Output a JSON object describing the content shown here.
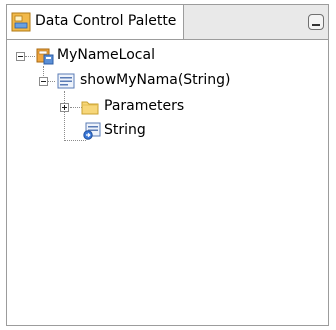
{
  "panel": {
    "tab_title": "Data Control Palette",
    "tab_icon": "data-control-palette-icon",
    "minimize_icon": "minimize-icon"
  },
  "tree": {
    "root": {
      "label": "MyNameLocal",
      "icon": "data-control-icon",
      "expanded": true
    },
    "method": {
      "label": "showMyNama(String)",
      "icon": "method-icon",
      "expanded": true
    },
    "parameters": {
      "label": "Parameters",
      "icon": "folder-icon",
      "expanded": false
    },
    "return_type": {
      "label": "String",
      "icon": "return-type-icon"
    }
  }
}
